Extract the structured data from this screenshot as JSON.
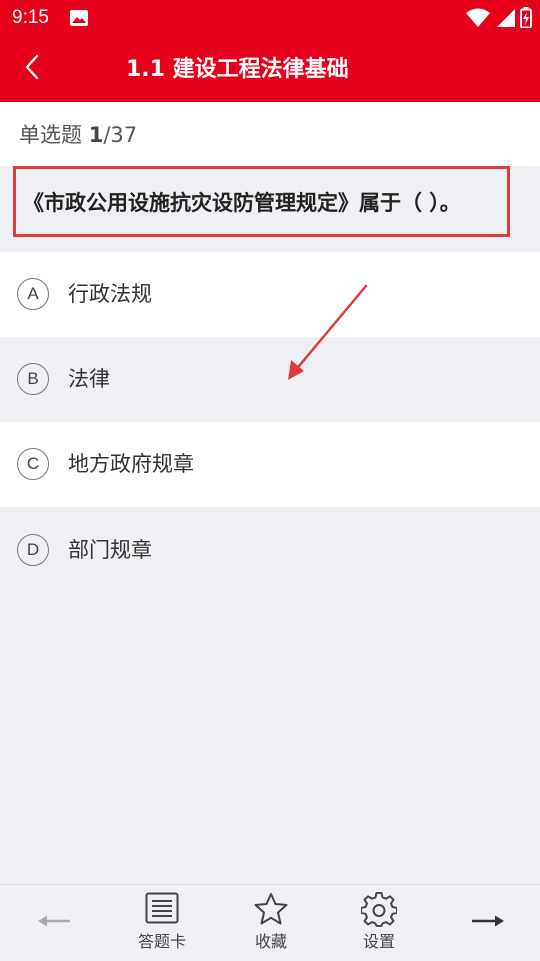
{
  "status": {
    "time": "9:15",
    "icons": [
      "gallery-icon",
      "wifi-icon",
      "signal-icon",
      "battery-icon"
    ]
  },
  "header": {
    "title": "1.1 建设工程法律基础",
    "back_icon": "chevron-left-icon"
  },
  "question_meta": {
    "type_label": "单选题",
    "current": "1",
    "total": "/37"
  },
  "question": {
    "text": "《市政公用设施抗灾设防管理规定》属于（   ）。"
  },
  "options": [
    {
      "letter": "A",
      "text": "行政法规"
    },
    {
      "letter": "B",
      "text": "法律"
    },
    {
      "letter": "C",
      "text": "地方政府规章"
    },
    {
      "letter": "D",
      "text": "部门规章"
    }
  ],
  "bottom_nav": {
    "prev_icon": "arrow-left-icon",
    "answer_card_label": "答题卡",
    "favorite_label": "收藏",
    "settings_label": "设置",
    "next_icon": "arrow-right-icon"
  },
  "colors": {
    "brand_red": "#e6001a",
    "highlight_border": "#e23a3a",
    "background": "#eef0f3"
  }
}
